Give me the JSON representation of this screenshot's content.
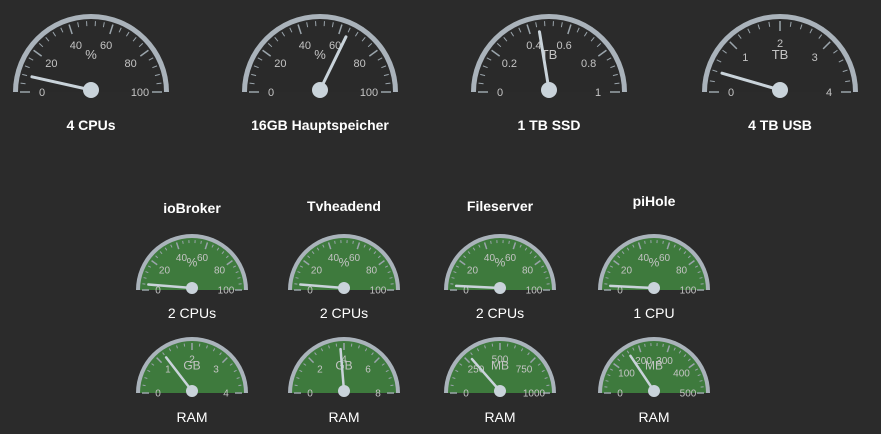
{
  "colors": {
    "background": "#2b2b2b",
    "dark_face": "#2a2a2a",
    "green_face": "#3e7a3d",
    "rim": "#aab3bb",
    "needle": "#c9d3da",
    "tick": "#9aa4ab",
    "label": "#c4c4c4",
    "caption": "#ffffff"
  },
  "top_gauges": [
    {
      "name": "cpu-gauge",
      "caption": "4 CPUs",
      "unit": "%",
      "min": 0,
      "max": 100,
      "value": 8,
      "labels": [
        "0",
        "20",
        "40",
        "60",
        "80",
        "100"
      ]
    },
    {
      "name": "memory-gauge",
      "caption": "16GB Hauptspeicher",
      "unit": "%",
      "min": 0,
      "max": 100,
      "value": 64,
      "labels": [
        "0",
        "20",
        "40",
        "60",
        "80",
        "100"
      ]
    },
    {
      "name": "ssd-gauge",
      "caption": "1 TB SSD",
      "unit": "TB",
      "min": 0,
      "max": 1,
      "value": 0.45,
      "labels": [
        "0",
        "0.2",
        "0.4",
        "0.6",
        "0.8",
        "1"
      ]
    },
    {
      "name": "usb-gauge",
      "caption": "4 TB USB",
      "unit": "TB",
      "min": 0,
      "max": 4,
      "value": 0.4,
      "labels": [
        "0",
        "1",
        "2",
        "3",
        "4"
      ]
    }
  ],
  "vms": [
    {
      "name": "iobroker",
      "title": "ioBroker",
      "cpu": {
        "caption": "2 CPUs",
        "unit": "%",
        "min": 0,
        "max": 100,
        "value": 4,
        "labels": [
          "0",
          "20",
          "40",
          "60",
          "80",
          "100"
        ]
      },
      "ram": {
        "caption": "RAM",
        "unit": "GB",
        "min": 0,
        "max": 4,
        "value": 1.2,
        "labels": [
          "0",
          "1",
          "2",
          "3",
          "4"
        ]
      }
    },
    {
      "name": "tvheadend",
      "title": "Tvheadend",
      "cpu": {
        "caption": "2 CPUs",
        "unit": "%",
        "min": 0,
        "max": 100,
        "value": 4,
        "labels": [
          "0",
          "20",
          "40",
          "60",
          "80",
          "100"
        ]
      },
      "ram": {
        "caption": "RAM",
        "unit": "GB",
        "min": 0,
        "max": 8,
        "value": 3.8,
        "labels": [
          "0",
          "2",
          "4",
          "6",
          "8"
        ]
      }
    },
    {
      "name": "fileserver",
      "title": "Fileserver",
      "cpu": {
        "caption": "2 CPUs",
        "unit": "%",
        "min": 0,
        "max": 100,
        "value": 3,
        "labels": [
          "0",
          "20",
          "40",
          "60",
          "80",
          "100"
        ]
      },
      "ram": {
        "caption": "RAM",
        "unit": "MB",
        "min": 0,
        "max": 1000,
        "value": 280,
        "labels": [
          "0",
          "250",
          "500",
          "750",
          "1000"
        ]
      }
    },
    {
      "name": "pihole",
      "title": "piHole",
      "cpu": {
        "caption": "1 CPU",
        "unit": "%",
        "min": 0,
        "max": 100,
        "value": 3,
        "labels": [
          "0",
          "20",
          "40",
          "60",
          "80",
          "100"
        ]
      },
      "ram": {
        "caption": "RAM",
        "unit": "MB",
        "min": 0,
        "max": 500,
        "value": 160,
        "labels": [
          "0",
          "100",
          "200",
          "300",
          "400",
          "500"
        ]
      }
    }
  ]
}
